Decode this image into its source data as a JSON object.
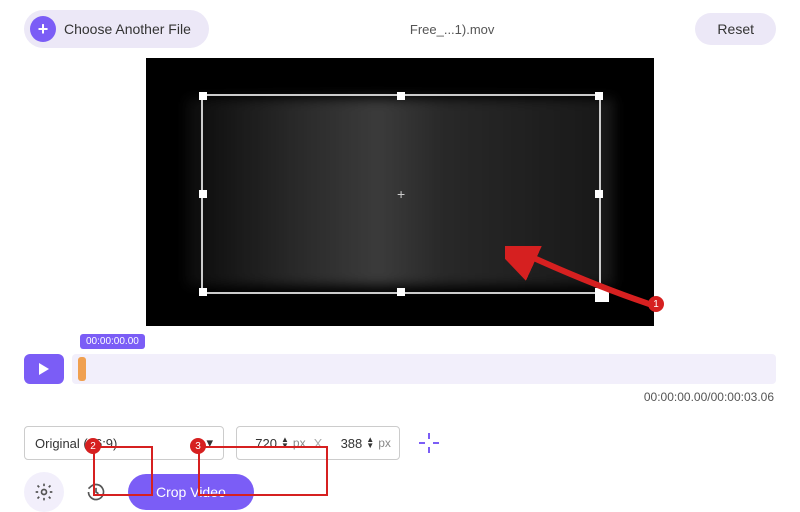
{
  "header": {
    "choose_label": "Choose Another File",
    "filename": "Free_...1).mov",
    "reset_label": "Reset"
  },
  "timeline": {
    "current_label": "00:00:00.00",
    "time_display": "00:00:00.00/00:00:03.06"
  },
  "controls": {
    "aspect_label": "Original (16:9)",
    "width_value": "720",
    "height_value": "388",
    "unit": "px",
    "separator": "X"
  },
  "actions": {
    "crop_label": "Crop Video"
  },
  "callouts": {
    "c1": "1",
    "c2": "2",
    "c3": "3"
  }
}
